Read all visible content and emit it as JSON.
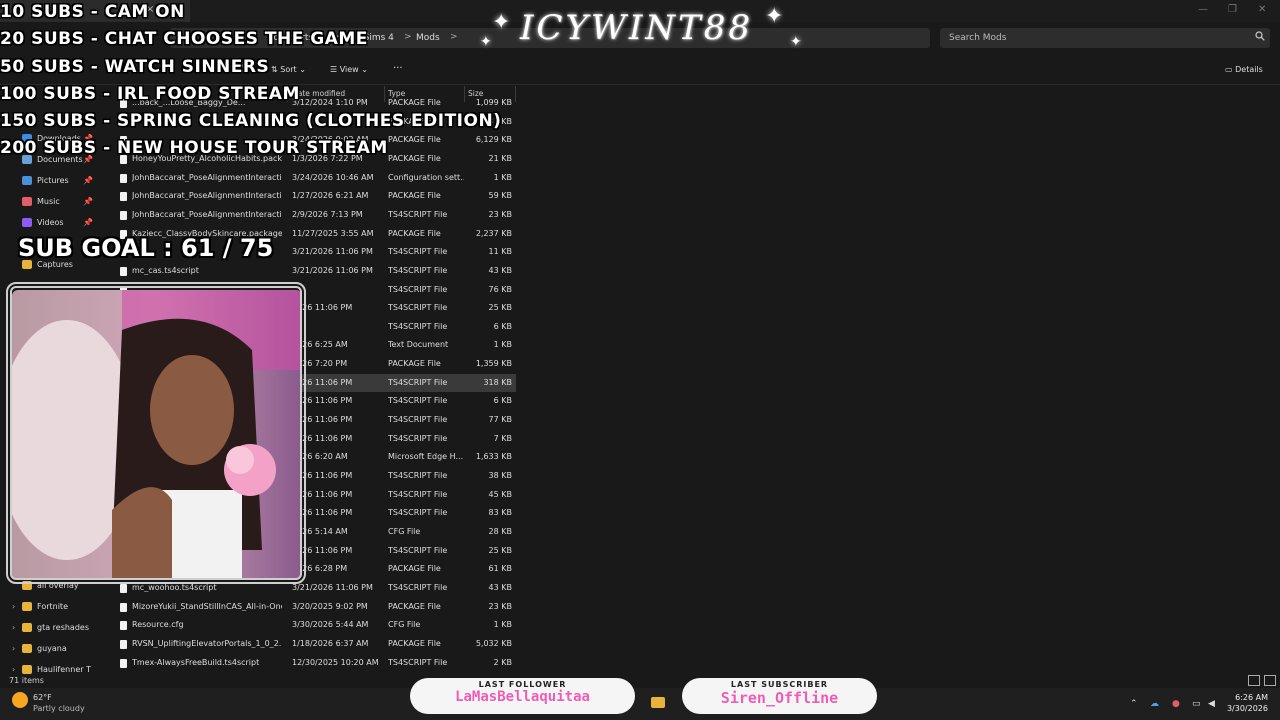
{
  "window": {
    "tab_title": "Mods",
    "tab_close": "×",
    "tab_add": "+"
  },
  "address": {
    "crumbs": [
      "ronic Arts",
      "The Sims 4",
      "Mods"
    ],
    "separator": ">",
    "search_placeholder": "Search Mods"
  },
  "toolbar": {
    "sort_label": "Sort",
    "view_label": "View",
    "more_label": "···",
    "details_label": "Details"
  },
  "nav": {
    "items": [
      {
        "label": "Downloads",
        "icon": "download-icon",
        "color": "#3a8ee6"
      },
      {
        "label": "Documents",
        "icon": "documents-icon",
        "color": "#6aa0d8"
      },
      {
        "label": "Pictures",
        "icon": "pictures-icon",
        "color": "#4a90d9"
      },
      {
        "label": "Music",
        "icon": "music-icon",
        "color": "#e35d6a"
      },
      {
        "label": "Videos",
        "icon": "videos-icon",
        "color": "#8b5cf6"
      },
      {
        "label": "Captures",
        "icon": "folder-icon",
        "color": "#e8b33a"
      },
      {
        "label": "all overlay",
        "icon": "folder-icon",
        "color": "#e8b33a"
      },
      {
        "label": "Fortnite",
        "icon": "folder-icon",
        "color": "#e8b33a"
      },
      {
        "label": "gta reshades",
        "icon": "folder-icon",
        "color": "#e8b33a"
      },
      {
        "label": "guyana",
        "icon": "folder-icon",
        "color": "#e8b33a"
      },
      {
        "label": "Haulifenner T",
        "icon": "folder-icon",
        "color": "#e8b33a"
      }
    ]
  },
  "columns": {
    "date": "Date modified",
    "type": "Type",
    "size": "Size"
  },
  "files": [
    {
      "name": "...back_...Loose_Baggy_De...",
      "date": "3/12/2024 1:10 PM",
      "type": "PACKAGE File",
      "size": "1,099 KB"
    },
    {
      "name": "",
      "date": "",
      "type": "PACKAGE File",
      "size": "81 KB"
    },
    {
      "name": "",
      "date": "3/24/2026 9:02 AM",
      "type": "PACKAGE File",
      "size": "6,129 KB"
    },
    {
      "name": "HoneyYouPretty_AlcoholicHabits.pack...",
      "date": "1/3/2026 7:22 PM",
      "type": "PACKAGE File",
      "size": "21 KB"
    },
    {
      "name": "JohnBaccarat_PoseAlignmentInteractions",
      "date": "3/24/2026 10:46 AM",
      "type": "Configuration sett...",
      "size": "1 KB"
    },
    {
      "name": "JohnBaccarat_PoseAlignmentInteraction...",
      "date": "1/27/2026 6:21 AM",
      "type": "PACKAGE File",
      "size": "59 KB"
    },
    {
      "name": "JohnBaccarat_PoseAlignmentInteraction...",
      "date": "2/9/2026 7:13 PM",
      "type": "TS4SCRIPT File",
      "size": "23 KB"
    },
    {
      "name": "Kaziecc_ClassyBodySkincare.package",
      "date": "11/27/2025 3:55 AM",
      "type": "PACKAGE File",
      "size": "2,237 KB"
    },
    {
      "name": "",
      "date": "3/21/2026 11:06 PM",
      "type": "TS4SCRIPT File",
      "size": "11 KB"
    },
    {
      "name": "mc_cas.ts4script",
      "date": "3/21/2026 11:06 PM",
      "type": "TS4SCRIPT File",
      "size": "43 KB"
    },
    {
      "name": "",
      "date": "",
      "type": "TS4SCRIPT File",
      "size": "76 KB"
    },
    {
      "name": "",
      "date": "2026 11:06 PM",
      "type": "TS4SCRIPT File",
      "size": "25 KB"
    },
    {
      "name": "",
      "date": "",
      "type": "TS4SCRIPT File",
      "size": "6 KB"
    },
    {
      "name": "",
      "date": "2026 6:25 AM",
      "type": "Text Document",
      "size": "1 KB"
    },
    {
      "name": "",
      "date": "2026 7:20 PM",
      "type": "PACKAGE File",
      "size": "1,359 KB"
    },
    {
      "name": "",
      "date": "2026 11:06 PM",
      "type": "TS4SCRIPT File",
      "size": "318 KB",
      "selected": true
    },
    {
      "name": "",
      "date": "2026 11:06 PM",
      "type": "TS4SCRIPT File",
      "size": "6 KB"
    },
    {
      "name": "",
      "date": "2026 11:06 PM",
      "type": "TS4SCRIPT File",
      "size": "77 KB"
    },
    {
      "name": "",
      "date": "2026 11:06 PM",
      "type": "TS4SCRIPT File",
      "size": "7 KB"
    },
    {
      "name": "",
      "date": "2026 6:20 AM",
      "type": "Microsoft Edge H...",
      "size": "1,633 KB"
    },
    {
      "name": "",
      "date": "2026 11:06 PM",
      "type": "TS4SCRIPT File",
      "size": "38 KB"
    },
    {
      "name": "",
      "date": "2026 11:06 PM",
      "type": "TS4SCRIPT File",
      "size": "45 KB"
    },
    {
      "name": "",
      "date": "2026 11:06 PM",
      "type": "TS4SCRIPT File",
      "size": "83 KB"
    },
    {
      "name": "",
      "date": "2026 5:14 AM",
      "type": "CFG File",
      "size": "28 KB"
    },
    {
      "name": "",
      "date": "2026 11:06 PM",
      "type": "TS4SCRIPT File",
      "size": "25 KB"
    },
    {
      "name": "",
      "date": "2026 6:28 PM",
      "type": "PACKAGE File",
      "size": "61 KB"
    },
    {
      "name": "mc_woohoo.ts4script",
      "date": "3/21/2026 11:06 PM",
      "type": "TS4SCRIPT File",
      "size": "43 KB"
    },
    {
      "name": "MizoreYukii_StandStillInCAS_All-in-One...",
      "date": "3/20/2025 9:02 PM",
      "type": "PACKAGE File",
      "size": "23 KB"
    },
    {
      "name": "Resource.cfg",
      "date": "3/30/2026 5:44 AM",
      "type": "CFG File",
      "size": "1 KB"
    },
    {
      "name": "RVSN_UpliftingElevatorPortals_1_0_2.pac...",
      "date": "1/18/2026 6:37 AM",
      "type": "PACKAGE File",
      "size": "5,032 KB"
    },
    {
      "name": "Tmex-AlwaysFreeBuild.ts4script",
      "date": "12/30/2025 10:20 AM",
      "type": "TS4SCRIPT File",
      "size": "2 KB"
    }
  ],
  "status": {
    "items": "71 items"
  },
  "taskbar": {
    "temp": "62°F",
    "weather": "Partly cloudy",
    "time": "6:26 AM",
    "date": "3/30/2026"
  },
  "overlay": {
    "goals": [
      "10 SUBS - CAM ON",
      "20 SUBS - CHAT CHOOSES THE GAME",
      "50 SUBS - WATCH SINNERS",
      "100 SUBS - IRL FOOD STREAM",
      "150 SUBS - SPRING CLEANING (CLOTHES EDITION)",
      "200 SUBS - NEW HOUSE TOUR STREAM"
    ],
    "sub_goal": "SUB GOAL : 61 / 75",
    "logo": "ICYWINT88",
    "last_follower_label": "LAST FOLLOWER",
    "last_follower_value": "LaMasBellaquitaa",
    "last_subscriber_label": "LAST SUBSCRIBER",
    "last_subscriber_value": "Siren_Offline",
    "accent": "#f15bb5"
  }
}
